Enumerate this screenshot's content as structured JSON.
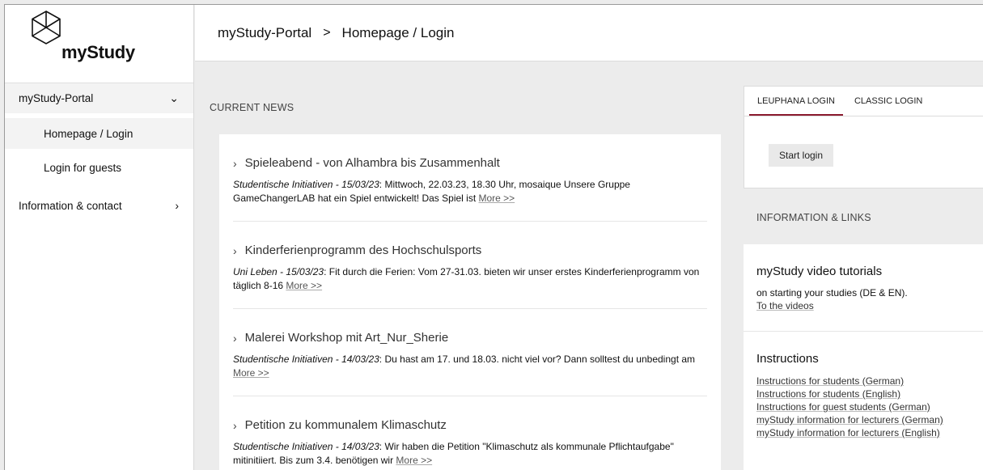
{
  "brand": {
    "logo_text": "myStudy"
  },
  "sidebar": {
    "items": [
      {
        "label": "myStudy-Portal",
        "chevron": "chevron-down-icon"
      },
      {
        "label": "Homepage / Login"
      },
      {
        "label": "Login for guests"
      },
      {
        "label": "Information & contact",
        "chevron": "chevron-right-icon"
      }
    ]
  },
  "header": {
    "crumb_root": "myStudy-Portal",
    "separator": ">",
    "crumb_current": "Homepage / Login"
  },
  "news": {
    "heading": "CURRENT NEWS",
    "items": [
      {
        "title": "Spieleabend - von Alhambra bis Zusammenhalt",
        "meta": "Studentische Initiativen - 15/03/23",
        "text": ": Mittwoch, 22.03.23, 18.30 Uhr, mosaique Unsere Gruppe GameChangerLAB hat ein Spiel entwickelt! Das Spiel ist ",
        "more": "More >>"
      },
      {
        "title": "Kinderferienprogramm des Hochschulsports",
        "meta": "Uni Leben - 15/03/23",
        "text": ": Fit durch die Ferien: Vom 27-31.03. bieten wir unser erstes Kinderferienprogramm von täglich 8-16 ",
        "more": "More >>"
      },
      {
        "title": "Malerei Workshop mit Art_Nur_Sherie",
        "meta": "Studentische Initiativen - 14/03/23",
        "text": ": Du hast am 17. und 18.03. nicht viel vor? Dann solltest du unbedingt am ",
        "more": "More >>"
      },
      {
        "title": "Petition zu kommunalem Klimaschutz",
        "meta": "Studentische Initiativen - 14/03/23",
        "text": ": Wir haben die Petition \"Klimaschutz als kommunale Pflichtaufgabe\" mitinitiiert. Bis zum 3.4. benötigen wir ",
        "more": "More >>"
      }
    ]
  },
  "login": {
    "tabs": [
      "LEUPHANA LOGIN",
      "CLASSIC LOGIN"
    ],
    "active_tab": "LEUPHANA LOGIN",
    "button": "Start login",
    "accent_color": "#8a1a2e"
  },
  "info": {
    "heading": "INFORMATION & LINKS",
    "video_title": "myStudy video tutorials",
    "video_text": "on starting your studies (DE & EN).",
    "video_link": "To the videos",
    "instructions_title": "Instructions",
    "instructions_links": [
      "Instructions for students (German)",
      "Instructions for students (English)",
      "Instructions for guest students (German)",
      "myStudy information for lecturers (German)",
      "myStudy information for lecturers (English)"
    ]
  }
}
